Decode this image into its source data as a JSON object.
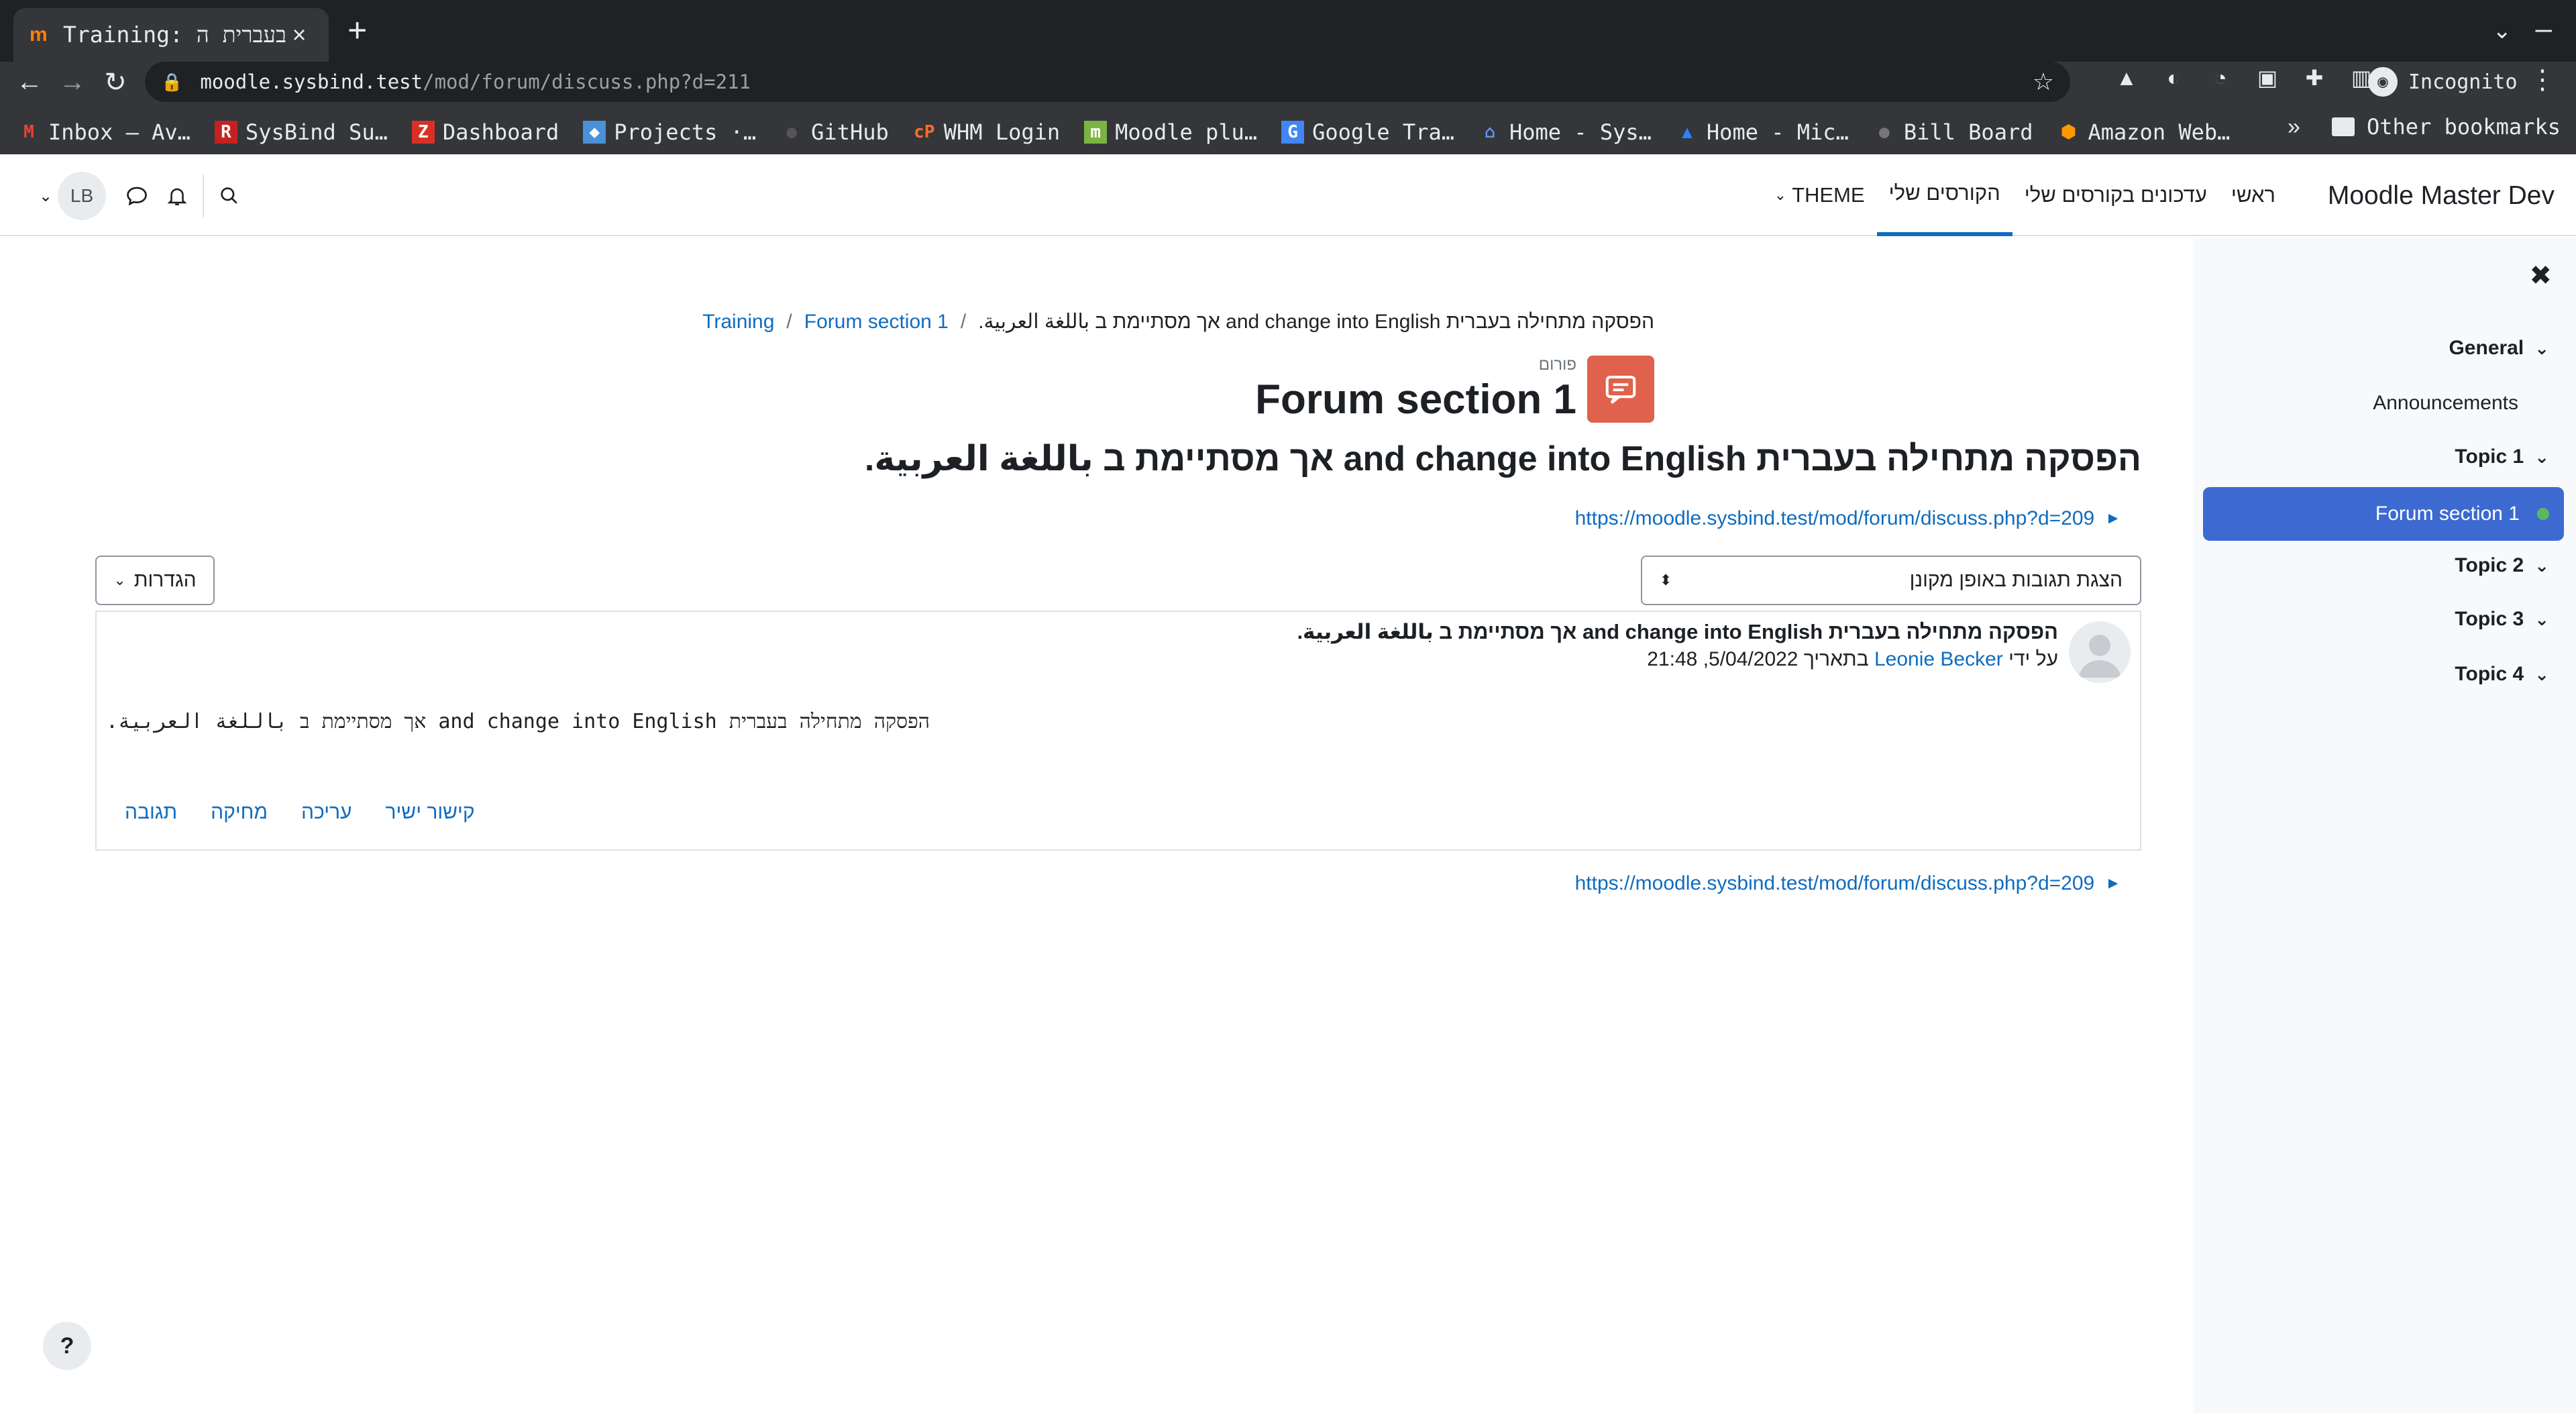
{
  "browser": {
    "tab_title": "Training: בעברית ה",
    "url_host": "moodle.sysbind.test",
    "url_path": "/mod/forum/discuss.php?d=211",
    "incognito_label": "Incognito",
    "bookmarks": [
      {
        "label": "Inbox – Av…",
        "icon": "gmail-icon"
      },
      {
        "label": "SysBind Su…",
        "icon": "r-icon"
      },
      {
        "label": "Dashboard",
        "icon": "z-icon"
      },
      {
        "label": "Projects ·…",
        "icon": "projects-icon"
      },
      {
        "label": "GitHub",
        "icon": "github-icon"
      },
      {
        "label": "WHM Login",
        "icon": "cpanel-icon"
      },
      {
        "label": "Moodle plu…",
        "icon": "moodle-icon"
      },
      {
        "label": "Google Tra…",
        "icon": "translate-icon"
      },
      {
        "label": "Home - Sys…",
        "icon": "home-icon"
      },
      {
        "label": "Home - Mic…",
        "icon": "atlassian-icon"
      },
      {
        "label": "Bill Board",
        "icon": "bill-icon"
      },
      {
        "label": "Amazon Web…",
        "icon": "aws-icon"
      }
    ],
    "bookmarks_more": "»",
    "other_bookmarks": "Other bookmarks"
  },
  "navbar": {
    "brand": "Moodle Master Dev",
    "items": [
      {
        "label": "ראשי"
      },
      {
        "label": "עדכונים בקורסים שלי"
      },
      {
        "label": "הקורסים שלי"
      },
      {
        "label": "THEME"
      }
    ],
    "user_initials": "LB"
  },
  "drawer": {
    "items": [
      {
        "label": "General"
      },
      {
        "label": "Announcements"
      },
      {
        "label": "Topic 1"
      },
      {
        "label": "Forum section 1"
      },
      {
        "label": "Topic 2"
      },
      {
        "label": "Topic 3"
      },
      {
        "label": "Topic 4"
      }
    ]
  },
  "breadcrumb": {
    "items": [
      {
        "label": "Training"
      },
      {
        "label": "Forum section 1"
      },
      {
        "label": "הפסקה מתחילה בעברית and change into English אך מסתיימת ב باللغة العربية."
      }
    ]
  },
  "page": {
    "activity_label": "פורום",
    "title": "Forum section 1",
    "discussion_title": "הפסקה מתחילה בעברית and change into English אך מסתיימת ב باللغة العربية.",
    "nav_link_top": "https://moodle.sysbind.test/mod/forum/discuss.php?d=209",
    "nav_link_bottom": "https://moodle.sysbind.test/mod/forum/discuss.php?d=209",
    "display_mode": "הצגת תגובות באופן מקונן",
    "settings_label": "הגדרות"
  },
  "post": {
    "subject": "הפסקה מתחילה בעברית and change into English אך מסתיימת ב باللغة العربية.",
    "by_prefix": "על ידי",
    "author": "Leonie Becker",
    "date_prefix": "בתאריך",
    "date": "5/04/2022, 21:48",
    "message": "הפסקה מתחילה בעברית and change into English אך מסתיימת ב باللغة العربية.",
    "actions": [
      {
        "label": "קישור ישיר"
      },
      {
        "label": "עריכה"
      },
      {
        "label": "מחיקה"
      },
      {
        "label": "תגובה"
      }
    ]
  },
  "help_label": "?",
  "colors": {
    "link": "#0f6cbf",
    "drawer_active": "#3c6ad1",
    "forum_icon": "#e0614c",
    "chrome_dark": "#202124"
  }
}
